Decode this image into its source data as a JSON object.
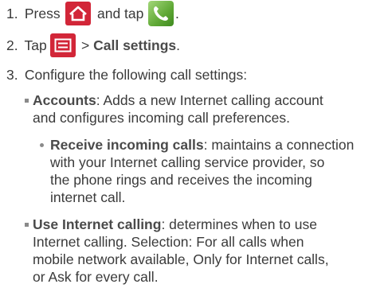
{
  "step1": {
    "num": "1.",
    "pre": "Press",
    "mid": "and tap",
    "end": "."
  },
  "step2": {
    "num": "2.",
    "pre": "Tap",
    "gt": ">",
    "bold": "Call settings",
    "end": "."
  },
  "step3": {
    "num": "3.",
    "text": "Configure the following call settings:"
  },
  "accounts": {
    "bold": "Accounts",
    "line1": ": Adds a new Internet calling account",
    "line2": "and configures incoming call preferences."
  },
  "receive": {
    "bold": "Receive incoming calls",
    "line1": ": maintains a connection",
    "line2": "with your Internet calling service provider, so",
    "line3": "the phone rings and receives the incoming",
    "line4": "internet call."
  },
  "use_internet": {
    "bold": "Use Internet calling",
    "line1": ": determines when to use",
    "line2": "Internet calling. Selection: For all calls when",
    "line3": "mobile network available, Only for Internet calls,",
    "line4": "or Ask for every call."
  },
  "icons": {
    "home": "home-icon",
    "phone": "phone-icon",
    "menu": "menu-icon"
  },
  "colors": {
    "icon_red": "#d22638",
    "icon_green": "#5fa835"
  }
}
